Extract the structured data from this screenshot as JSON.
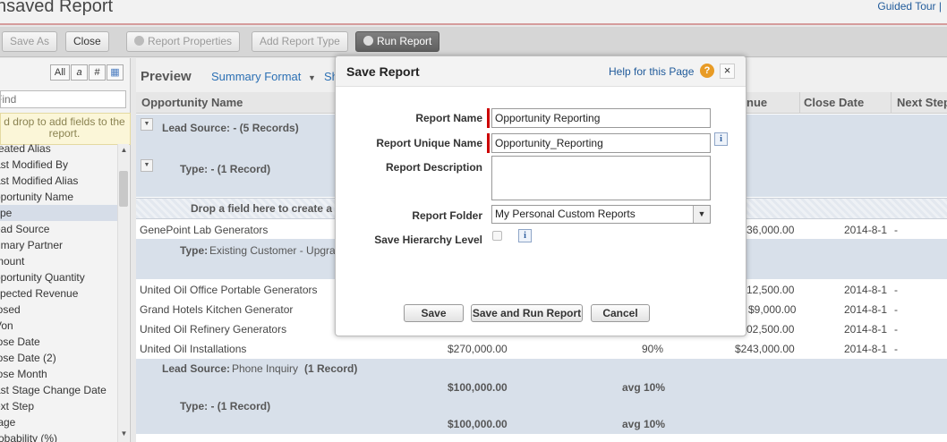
{
  "header": {
    "title": "nsaved Report",
    "guided_tour": "Guided Tour |"
  },
  "toolbar": {
    "save_as": "Save As",
    "close": "Close",
    "report_properties": "Report Properties",
    "add_report_type": "Add Report Type",
    "run_report": "Run Report"
  },
  "left_panel": {
    "filters": [
      "All",
      "a",
      "#",
      "▦"
    ],
    "find_placeholder": "Find",
    "drag_hint": "d drop to add fields to the report.",
    "fields": [
      "reated Alias",
      "ast Modified By",
      "ast Modified Alias",
      "pportunity Name",
      "ype",
      "ead Source",
      "rimary Partner",
      "mount",
      "pportunity Quantity",
      "xpected Revenue",
      "losed",
      "Von",
      "lose Date",
      "lose Date (2)",
      "lose Month",
      "ast Stage Change Date",
      "ext Step",
      "tage",
      "robability (%)"
    ],
    "selected_index": 4
  },
  "preview": {
    "label": "Preview",
    "summary_format": "Summary Format",
    "show": "Sh",
    "columns": {
      "opportunity_name": "Opportunity Name",
      "revenue": "nue",
      "close_date": "Close Date",
      "next_step": "Next Step"
    },
    "group_lead_source_1": "Lead Source: - (5 Records)",
    "group_type_1": "Type: - (1 Record)",
    "drop_zone": "Drop a field here to create a",
    "rows": {
      "genepoint": {
        "name": "GenePoint Lab Generators",
        "revenue": "36,000.00",
        "date": "2014-8-1",
        "next": "-"
      },
      "type_existing_prefix": "Type:",
      "type_existing_value": "Existing Customer - Upgra",
      "uo_office": {
        "name": "United Oil Office Portable Generators",
        "revenue": "12,500.00",
        "date": "2014-8-1",
        "next": "-"
      },
      "grand_hotels": {
        "name": "Grand Hotels Kitchen Generator",
        "revenue": "$9,000.00",
        "date": "2014-8-1",
        "next": "-"
      },
      "uo_refinery": {
        "name": "United Oil Refinery Generators",
        "revenue": "02,500.00",
        "date": "2014-8-1",
        "next": "-"
      },
      "uo_install": {
        "name": "United Oil Installations",
        "amount": "$270,000.00",
        "probability": "90%",
        "revenue": "$243,000.00",
        "date": "2014-8-1",
        "next": "-"
      }
    },
    "group_lead_phone_prefix": "Lead Source:",
    "group_lead_phone_value": "Phone Inquiry",
    "group_lead_phone_count": "(1 Record)",
    "sum_1_amount": "$100,000.00",
    "sum_1_prob": "avg 10%",
    "group_type_2": "Type: - (1 Record)",
    "sum_2_amount": "$100,000.00",
    "sum_2_prob": "avg 10%"
  },
  "modal": {
    "title": "Save Report",
    "help": "Help for this Page",
    "help_icon": "?",
    "close_icon": "×",
    "labels": {
      "name": "Report Name",
      "unique_name": "Report Unique Name",
      "description": "Report Description",
      "folder": "Report Folder",
      "hierarchy": "Save Hierarchy Level"
    },
    "values": {
      "name": "Opportunity Reporting",
      "unique_name": "Opportunity_Reporting",
      "description": "",
      "folder": "My Personal Custom Reports"
    },
    "buttons": {
      "save": "Save",
      "save_and_run": "Save and Run Report",
      "cancel": "Cancel"
    }
  }
}
